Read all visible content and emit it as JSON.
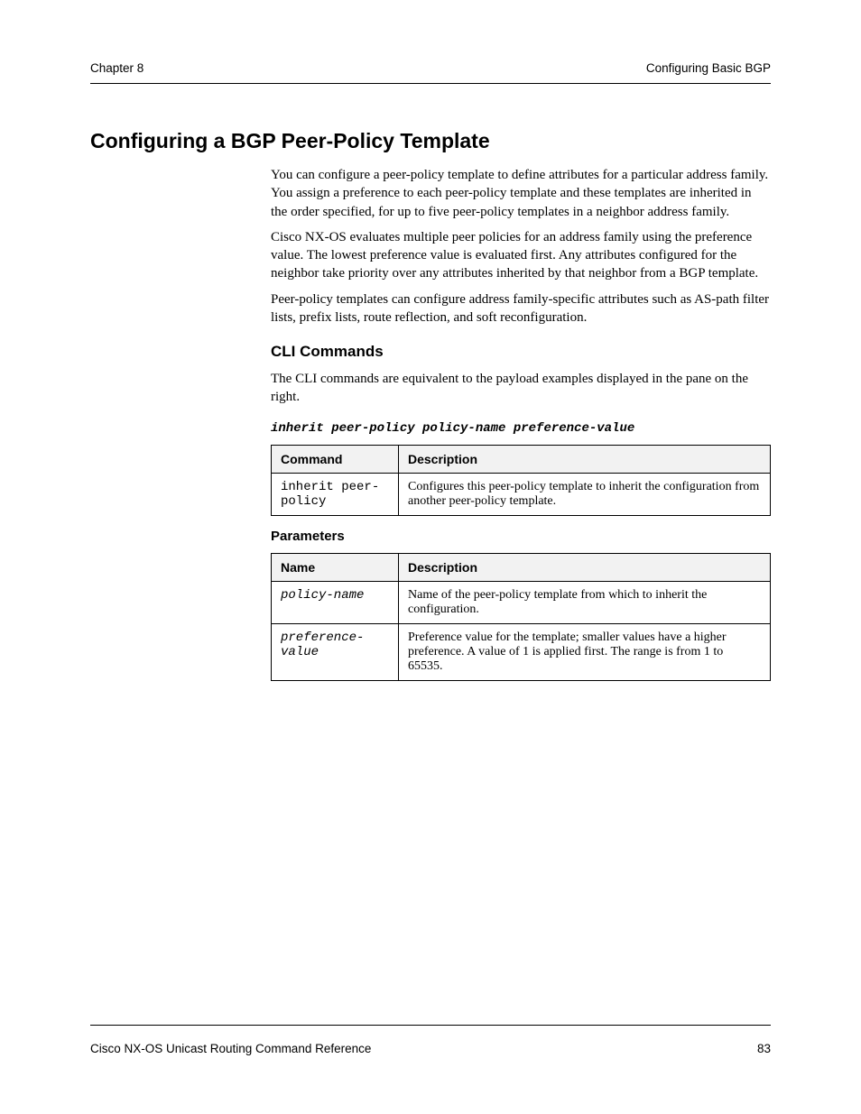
{
  "header": {
    "left": "Chapter 8",
    "right": "Configuring Basic BGP"
  },
  "footer": {
    "left": "Cisco NX-OS Unicast Routing Command Reference",
    "right": "83"
  },
  "sections": {
    "title": "Configuring a BGP Peer-Policy Template",
    "intro_p1": "You can configure a peer-policy template to define attributes for a particular address family. You assign a preference to each peer-policy template and these templates are inherited in the order specified, for up to five peer-policy templates in a neighbor address family.",
    "intro_p2": "Cisco NX-OS evaluates multiple peer policies for an address family using the preference value. The lowest preference value is evaluated first. Any attributes configured for the neighbor take priority over any attributes inherited by that neighbor from a BGP template.",
    "intro_p3": "Peer-policy templates can configure address family-specific attributes such as AS-path filter lists, prefix lists, route reflection, and soft reconfiguration.",
    "cli_heading": "CLI Commands",
    "cli_intro": "The CLI commands are equivalent to the payload examples displayed in the pane on the right.",
    "inherit_cmd": "inherit peer-policy policy-name preference-value",
    "param_heading": "Parameters"
  },
  "table1": {
    "headers": [
      "Command",
      "Description"
    ],
    "rows": [
      {
        "cmd": "inherit peer-policy",
        "desc": "Configures this peer-policy template to inherit the configuration from another peer-policy template."
      }
    ]
  },
  "table2": {
    "headers": [
      "Name",
      "Description"
    ],
    "rows": [
      {
        "name": "policy-name",
        "desc": "Name of the peer-policy template from which to inherit the configuration."
      },
      {
        "name": "preference-value",
        "desc": "Preference value for the template; smaller values have a higher preference. A value of 1 is applied first. The range is from 1 to 65535."
      }
    ]
  }
}
